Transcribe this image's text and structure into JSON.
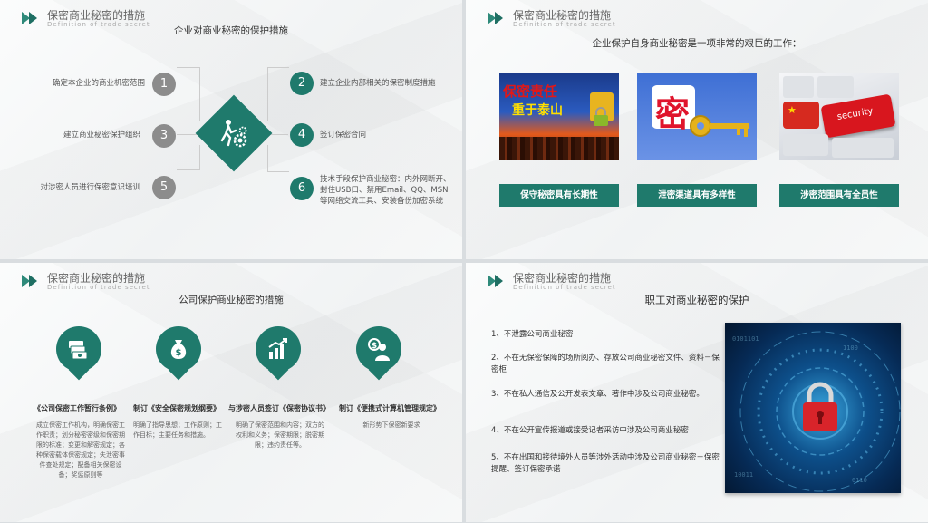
{
  "header": {
    "title": "保密商业秘密的措施",
    "subtitle": "Definition of trade secret"
  },
  "slide1": {
    "title": "企业对商业秘密的保护措施",
    "items": [
      {
        "num": "1",
        "text": "确定本企业的商业机密范围"
      },
      {
        "num": "2",
        "text": "建立企业内部相关的保密制度措施"
      },
      {
        "num": "3",
        "text": "建立商业秘密保护组织"
      },
      {
        "num": "4",
        "text": "签订保密合同"
      },
      {
        "num": "5",
        "text": "对涉密人员进行保密意识培训"
      },
      {
        "num": "6",
        "text": "技术手段保护商业秘密：内外网断开、封住USB口、禁用Email、QQ、MSN等网络交流工具、安装备份加密系统"
      }
    ],
    "center_icon": "person-gears-icon"
  },
  "slide2": {
    "title": "企业保护自身商业秘密是一项非常的艰巨的工作：",
    "images": [
      {
        "icon": "secret-responsibility-image",
        "caption_lines": [
          "保密责任",
          "重于泰山"
        ]
      },
      {
        "icon": "key-secret-image",
        "caption_lines": [
          "密"
        ]
      },
      {
        "icon": "security-keyboard-image",
        "caption_lines": [
          "security"
        ]
      }
    ],
    "buttons": [
      "保守秘密具有长期性",
      "泄密渠道具有多样性",
      "涉密范围具有全员性"
    ]
  },
  "slide3": {
    "title": "公司保护商业秘密的措施",
    "columns": [
      {
        "icon": "money-stack-icon",
        "title": "《公司保密工作暂行条例》",
        "body": "成立保密工作机构，明确保密工作职责；划分秘密密级和保密期限的标准；变更和解密规定；各种保密载体保密规定；失泄密事件查处规定；配备相关保密设备；奖惩原则等"
      },
      {
        "icon": "money-bag-icon",
        "title": "制订《安全保密规划纲要》",
        "body": "明确了指导思想；工作原则；工作目标；主要任务和措施。"
      },
      {
        "icon": "growth-chart-icon",
        "title": "与涉密人员签订《保密协议书》",
        "body": "明确了保密范围和内容；双方的权利和义务；保密期限；脱密期限；违约责任等。"
      },
      {
        "icon": "business-person-icon",
        "title": "制订《便携式计算机管理规定》",
        "body": "新形势下保密新要求"
      }
    ]
  },
  "slide4": {
    "title": "职工对商业秘密的保护",
    "items": [
      "1、不泄露公司商业秘密",
      "2、不在无保密保障的场所阅办、存放公司商业秘密文件、资料－保密柜",
      "3、不在私人通信及公开发表文章、著作中涉及公司商业秘密。",
      "4、不在公开宣传报道或接受记者采访中涉及公司商业秘密",
      "5、不在出国和接待境外人员等涉外活动中涉及公司商业秘密－保密提醒、签订保密承诺"
    ],
    "image_icon": "digital-lock-image"
  },
  "colors": {
    "accent": "#1f7a6c",
    "gray": "#8c8c8c"
  }
}
